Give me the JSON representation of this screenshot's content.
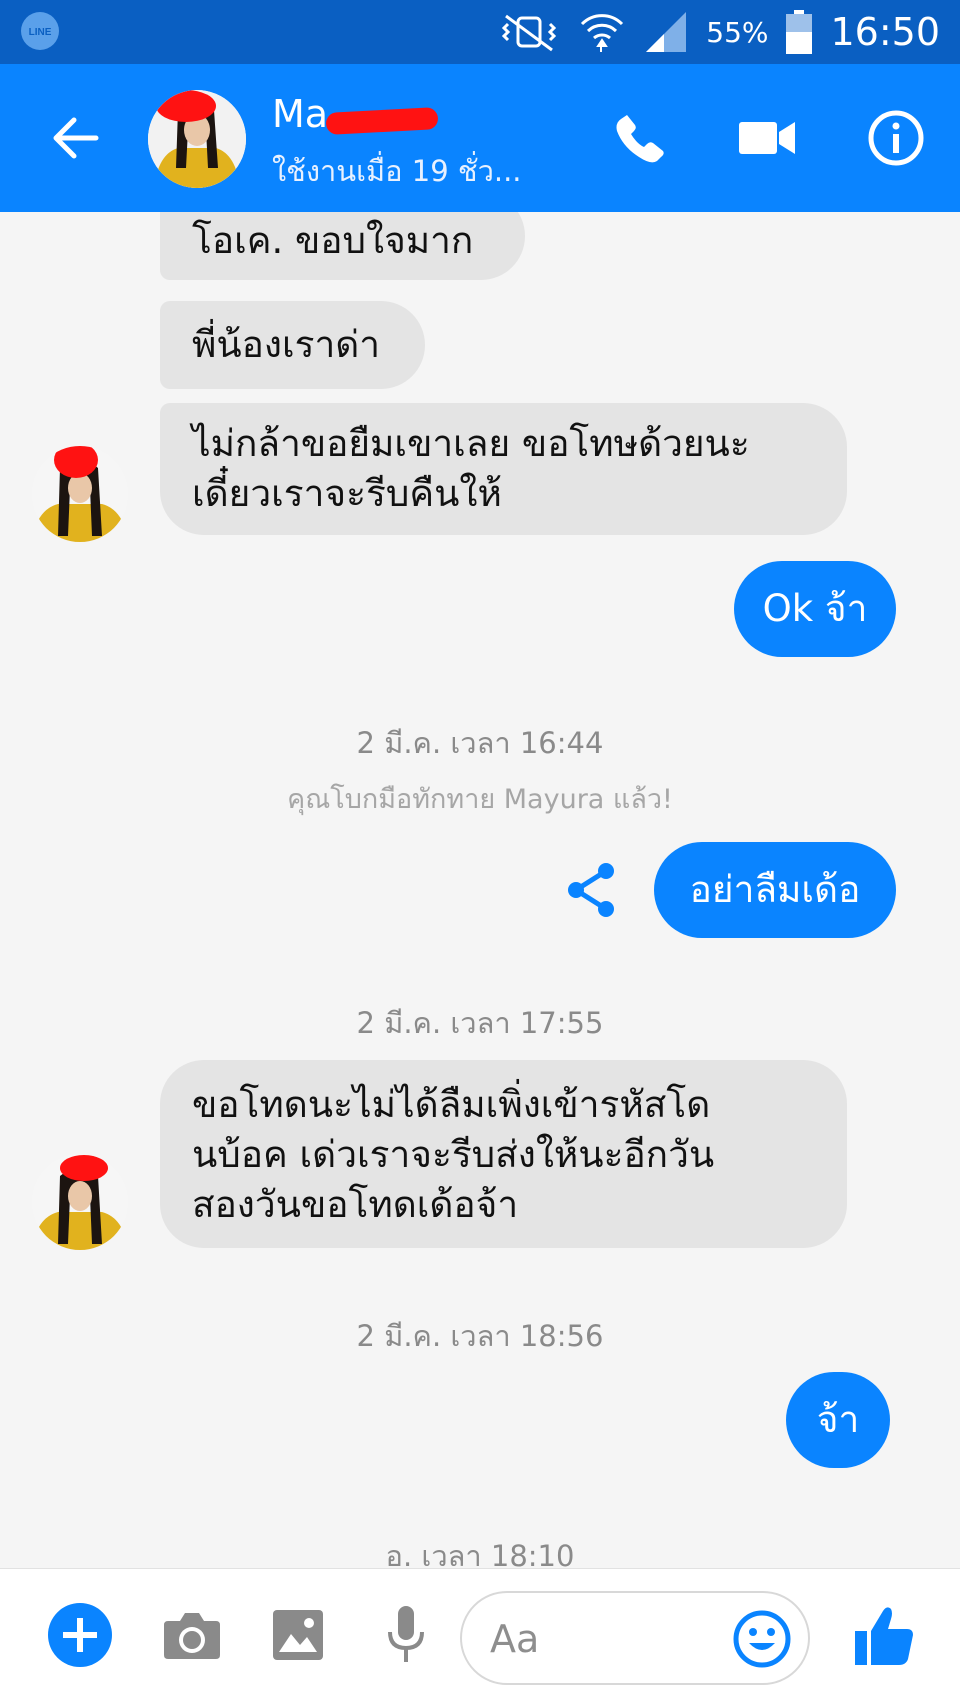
{
  "status_bar": {
    "battery_percent": "55%",
    "time": "16:50",
    "app_icon": "line-app-icon",
    "icons": [
      "mute-vibrate-icon",
      "wifi-icon",
      "signal-icon",
      "battery-icon"
    ]
  },
  "header": {
    "contact_name": "Ma",
    "active_status": "ใช้งานเมื่อ 19 ชั่ว...",
    "icons": [
      "back-arrow-icon",
      "phone-icon",
      "video-camera-icon",
      "info-icon"
    ],
    "accent": "#0a84ff"
  },
  "messages": [
    {
      "from": "them",
      "text": "โอเค. ขอบใจมาก"
    },
    {
      "from": "them",
      "text": "พี่น้องเราด่า"
    },
    {
      "from": "them",
      "lines": [
        "ไม่กล้าขอยืมเขาเลย ขอโทษด้วยนะ",
        "เดี๋ยวเราจะรีบคืนให้"
      ]
    },
    {
      "from": "me",
      "text": "Ok จ้า"
    },
    {
      "timestamp": "2 มี.ค. เวลา 16:44"
    },
    {
      "notice": "คุณโบกมือทักทาย Mayura แล้ว!"
    },
    {
      "from": "me",
      "text": "อย่าลืมเด้อ"
    },
    {
      "timestamp": "2 มี.ค. เวลา 17:55"
    },
    {
      "from": "them",
      "lines": [
        "ขอโทดนะไม่ได้ลืมเพิ่งเข้ารหัสโด",
        "นบ้อค เด่วเราจะรีบส่งให้นะอีกวัน",
        "สองวันขอโทดเด้อจ้า"
      ]
    },
    {
      "timestamp": "2 มี.ค. เวลา 18:56"
    },
    {
      "from": "me",
      "text": "จ้า"
    },
    {
      "timestamp": "อ. เวลา 18:10"
    }
  ],
  "composer": {
    "placeholder": "Aa",
    "icons": [
      "plus-icon",
      "camera-icon",
      "image-icon",
      "microphone-icon",
      "emoji-icon",
      "thumbs-up-icon"
    ]
  }
}
